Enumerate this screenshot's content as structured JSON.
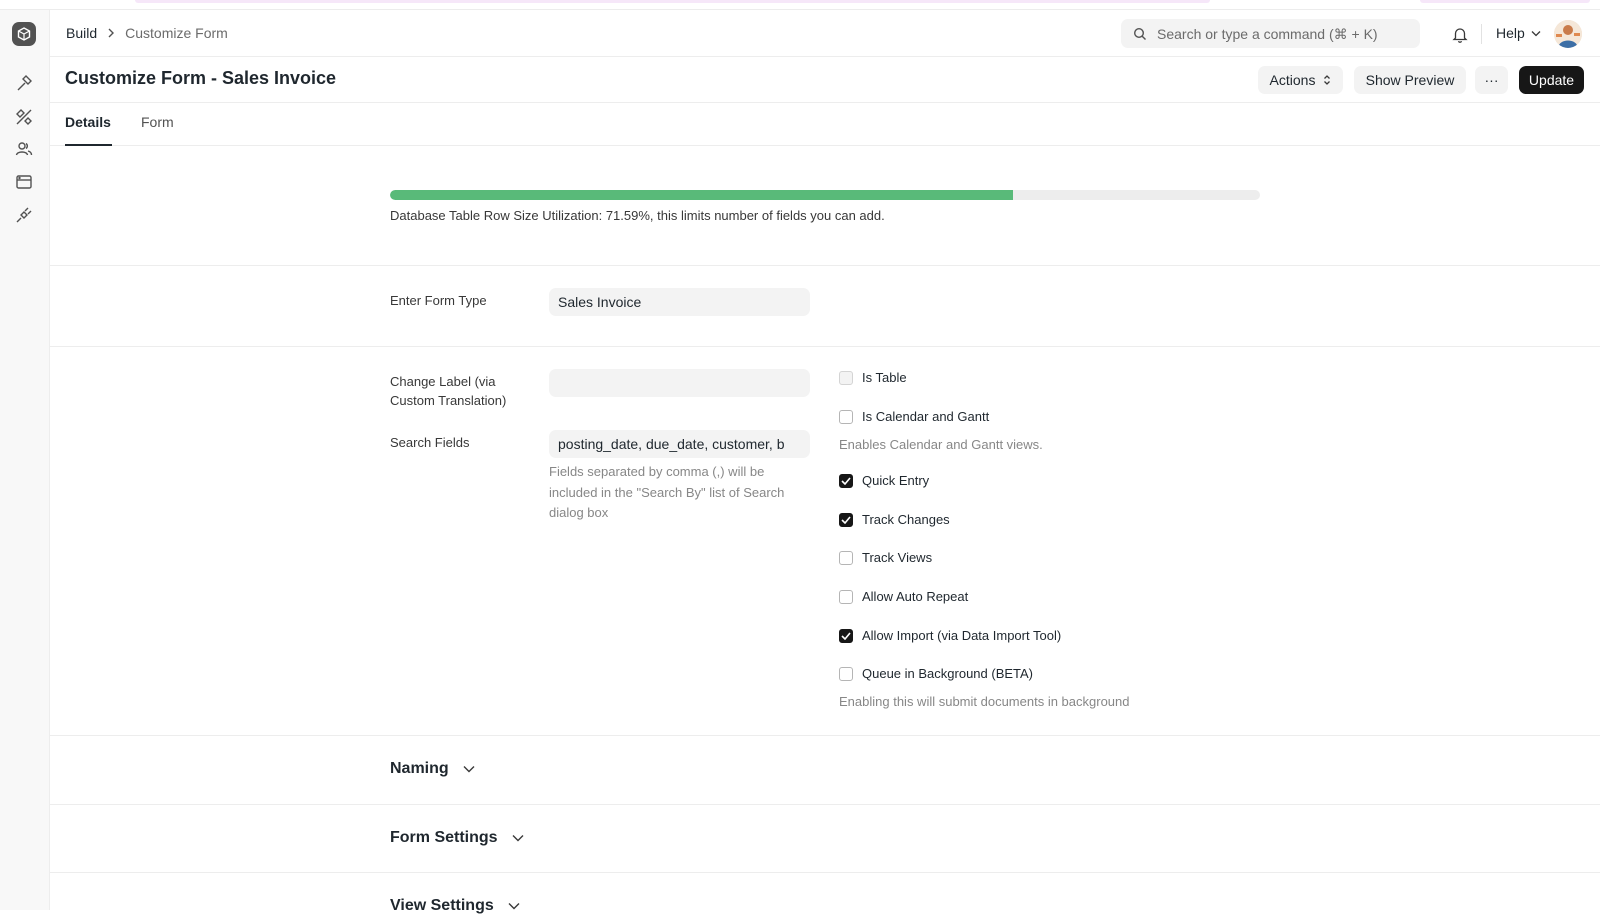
{
  "breadcrumb": {
    "root": "Build",
    "current": "Customize Form"
  },
  "search": {
    "placeholder": "Search or type a command (⌘ + K)"
  },
  "help": {
    "label": "Help"
  },
  "page": {
    "title": "Customize Form - Sales Invoice"
  },
  "toolbar": {
    "actions_label": "Actions",
    "preview_label": "Show Preview",
    "more_label": "···",
    "update_label": "Update"
  },
  "tabs": [
    {
      "label": "Details",
      "active": true
    },
    {
      "label": "Form",
      "active": false
    }
  ],
  "utilization": {
    "value": 0.7159,
    "text": "Database Table Row Size Utilization: 71.59%, this limits number of fields you can add."
  },
  "form_type": {
    "label": "Enter Form Type",
    "value": "Sales Invoice"
  },
  "change_label": {
    "label_line1": "Change Label (via",
    "label_line2": "Custom Translation)",
    "value": ""
  },
  "search_fields": {
    "label": "Search Fields",
    "value": "posting_date, due_date, customer, b",
    "help_line1": "Fields separated by comma (,) will be",
    "help_line2": "included in the \"Search By\" list of Search",
    "help_line3": "dialog box"
  },
  "checkboxes": [
    {
      "label": "Is Table",
      "checked": false,
      "disabled": true
    },
    {
      "label": "Is Calendar and Gantt",
      "checked": false,
      "help": "Enables Calendar and Gantt views."
    },
    {
      "label": "Quick Entry",
      "checked": true
    },
    {
      "label": "Track Changes",
      "checked": true
    },
    {
      "label": "Track Views",
      "checked": false
    },
    {
      "label": "Allow Auto Repeat",
      "checked": false
    },
    {
      "label": "Allow Import (via Data Import Tool)",
      "checked": true
    },
    {
      "label": "Queue in Background (BETA)",
      "checked": false,
      "help": "Enabling this will submit documents in background"
    }
  ],
  "sections": [
    {
      "label": "Naming"
    },
    {
      "label": "Form Settings"
    },
    {
      "label": "View Settings"
    }
  ],
  "colors": {
    "accent": "#59ba79",
    "primary_button": "#171717"
  }
}
